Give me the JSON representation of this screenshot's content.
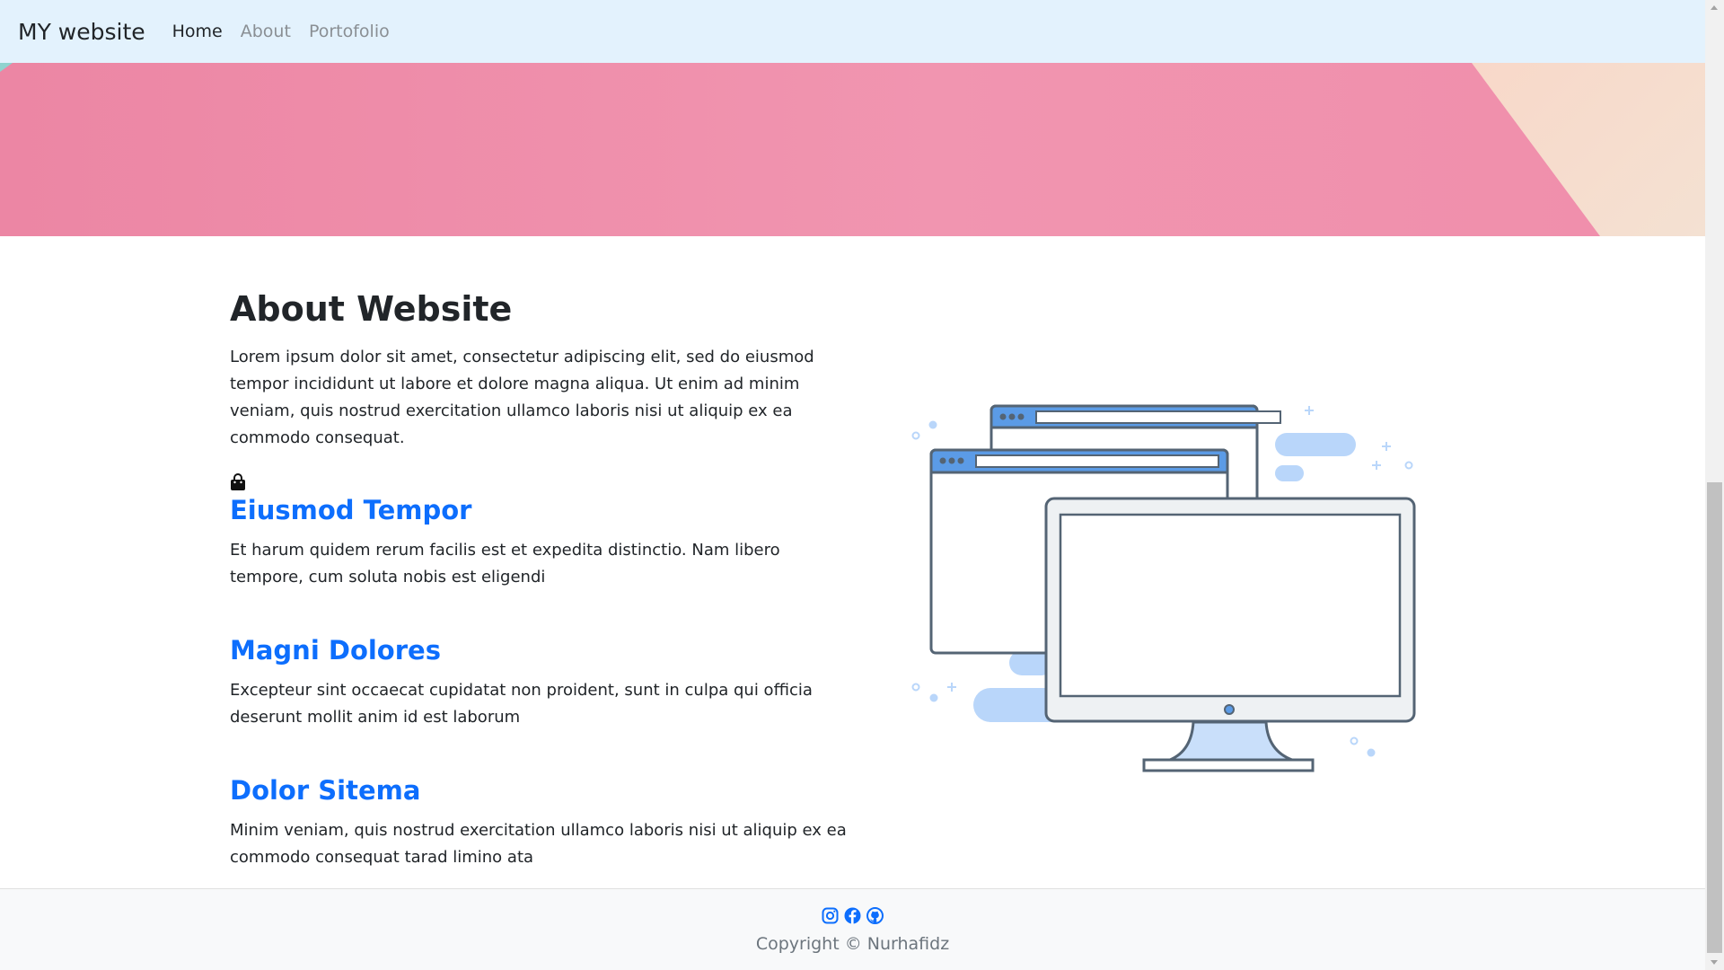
{
  "navbar": {
    "brand": "MY website",
    "links": [
      {
        "label": "Home",
        "active": true
      },
      {
        "label": "About",
        "active": false
      },
      {
        "label": "Portofolio",
        "active": false
      }
    ]
  },
  "about": {
    "title": "About Website",
    "text": "Lorem ipsum dolor sit amet, consectetur adipiscing elit, sed do eiusmod tempor incididunt ut labore et dolore magna aliqua. Ut enim ad minim veniam, quis nostrud exercitation ullamco laboris nisi ut aliquip ex ea commodo consequat.",
    "icon": "shopping-bag-icon",
    "features": [
      {
        "title": "Eiusmod Tempor",
        "text": "Et harum quidem rerum facilis est et expedita distinctio. Nam libero tempore, cum soluta nobis est eligendi"
      },
      {
        "title": "Magni Dolores",
        "text": "Excepteur sint occaecat cupidatat non proident, sunt in culpa qui officia deserunt mollit anim id est laborum"
      },
      {
        "title": "Dolor Sitema",
        "text": "Minim veniam, quis nostrud exercitation ullamco laboris nisi ut aliquip ex ea commodo consequat tarad limino ata"
      }
    ]
  },
  "footer": {
    "social_icons": [
      "instagram-icon",
      "facebook-icon",
      "github-icon"
    ],
    "copyright": "Copyright © Nurhafidz"
  },
  "colors": {
    "navbar_bg": "#e3f2fd",
    "link_blue": "#0d6efd",
    "hero_pink": "#f195b0",
    "hero_peach": "#f6dccd",
    "illustration_blue": "#5b9be6",
    "illustration_stroke": "#546474"
  }
}
